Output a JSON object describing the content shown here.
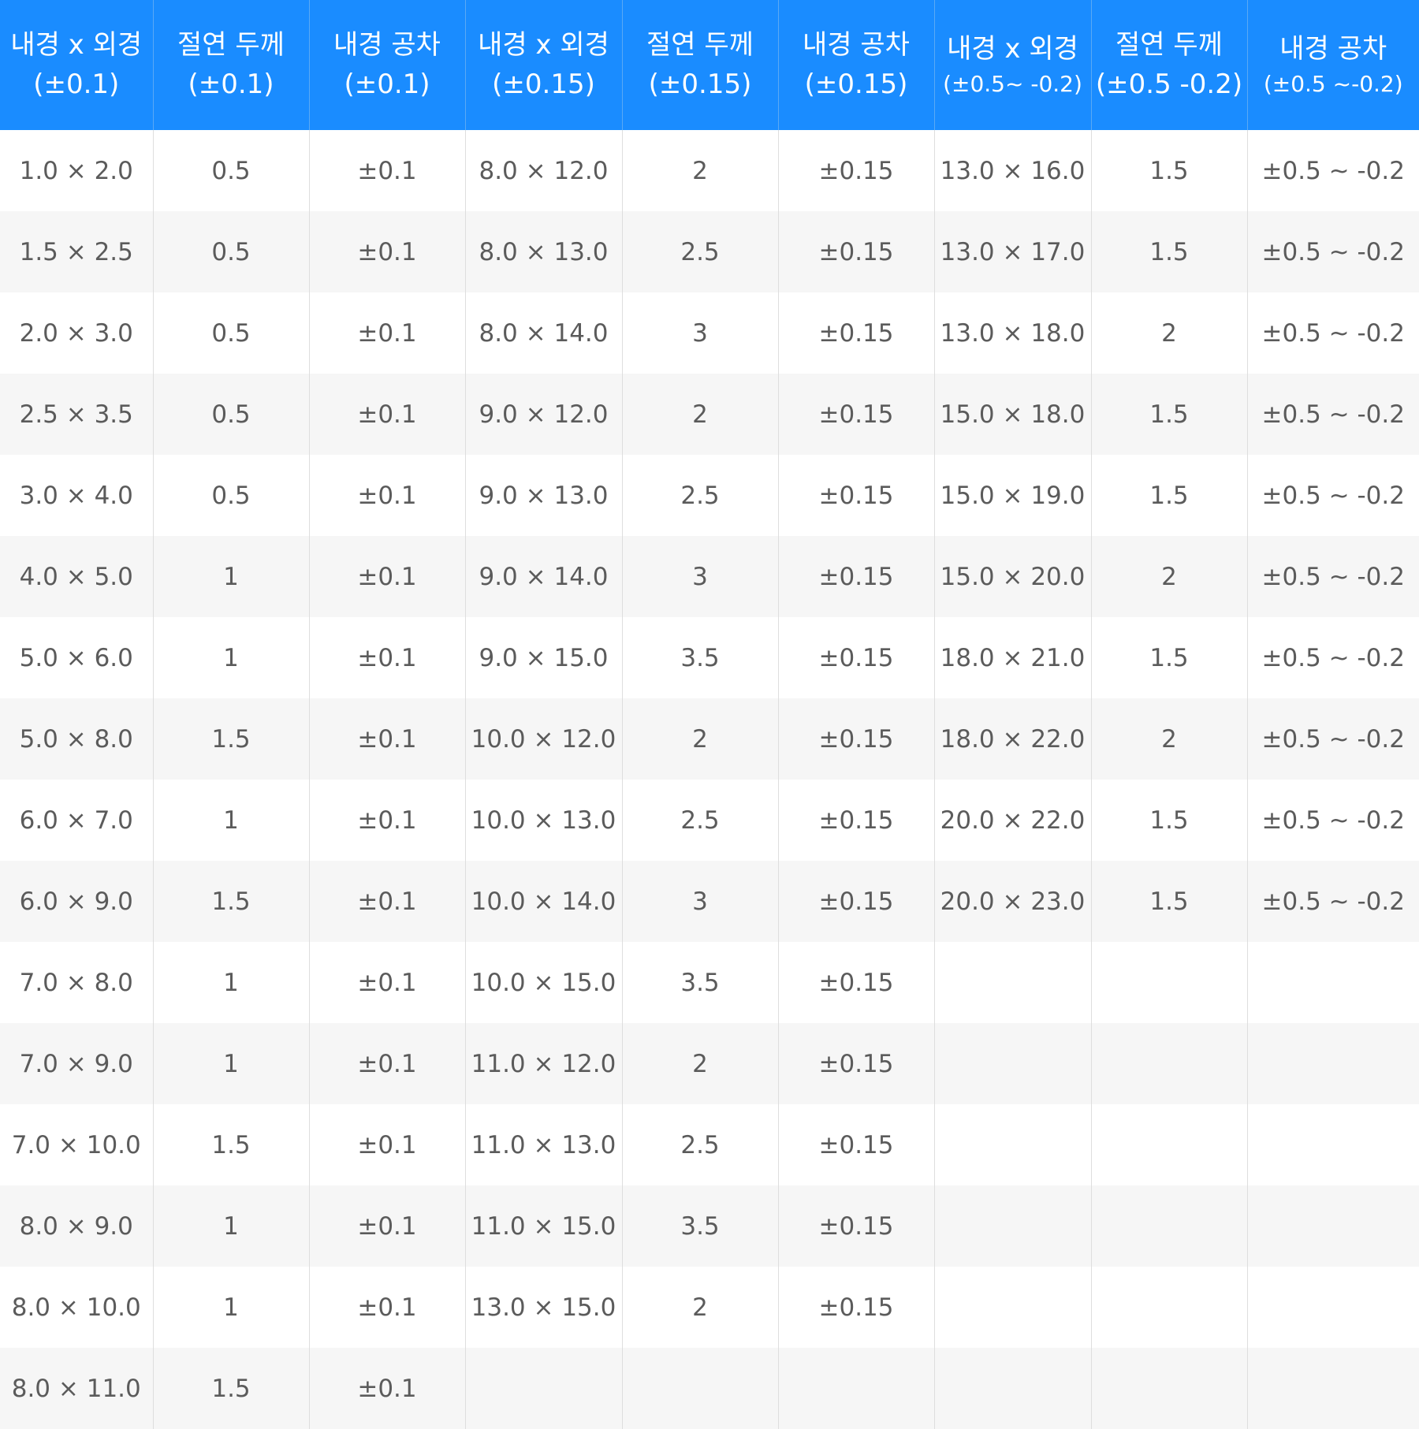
{
  "headers": [
    {
      "line1": "내경 x 외경",
      "line2": "(±0.1)"
    },
    {
      "line1": "절연 두께",
      "line2": "(±0.1)"
    },
    {
      "line1": "내경 공차",
      "line2": "(±0.1)"
    },
    {
      "line1": "내경 x 외경",
      "line2": "(±0.15)"
    },
    {
      "line1": "절연 두께",
      "line2": "(±0.15)"
    },
    {
      "line1": "내경 공차",
      "line2": "(±0.15)"
    },
    {
      "line1": "내경 x 외경",
      "line2": "(±0.5~ -0.2)"
    },
    {
      "line1": "절연 두께",
      "line2": "(±0.5 -0.2)"
    },
    {
      "line1": "내경 공차",
      "line2": "(±0.5 ~-0.2)"
    }
  ],
  "rows": [
    [
      "1.0 × 2.0",
      "0.5",
      "±0.1",
      "8.0 × 12.0",
      "2",
      "±0.15",
      "13.0 × 16.0",
      "1.5",
      "±0.5 ~ -0.2"
    ],
    [
      "1.5 × 2.5",
      "0.5",
      "±0.1",
      "8.0 × 13.0",
      "2.5",
      "±0.15",
      "13.0 × 17.0",
      "1.5",
      "±0.5 ~ -0.2"
    ],
    [
      "2.0 × 3.0",
      "0.5",
      "±0.1",
      "8.0 × 14.0",
      "3",
      "±0.15",
      "13.0 × 18.0",
      "2",
      "±0.5 ~ -0.2"
    ],
    [
      "2.5 × 3.5",
      "0.5",
      "±0.1",
      "9.0 × 12.0",
      "2",
      "±0.15",
      "15.0 × 18.0",
      "1.5",
      "±0.5 ~ -0.2"
    ],
    [
      "3.0 × 4.0",
      "0.5",
      "±0.1",
      "9.0 × 13.0",
      "2.5",
      "±0.15",
      "15.0 × 19.0",
      "1.5",
      "±0.5 ~ -0.2"
    ],
    [
      "4.0 × 5.0",
      "1",
      "±0.1",
      "9.0 × 14.0",
      "3",
      "±0.15",
      "15.0 × 20.0",
      "2",
      "±0.5 ~ -0.2"
    ],
    [
      "5.0 × 6.0",
      "1",
      "±0.1",
      "9.0 × 15.0",
      "3.5",
      "±0.15",
      "18.0 × 21.0",
      "1.5",
      "±0.5 ~ -0.2"
    ],
    [
      "5.0 × 8.0",
      "1.5",
      "±0.1",
      "10.0 × 12.0",
      "2",
      "±0.15",
      "18.0 × 22.0",
      "2",
      "±0.5 ~ -0.2"
    ],
    [
      "6.0 × 7.0",
      "1",
      "±0.1",
      "10.0 × 13.0",
      "2.5",
      "±0.15",
      "20.0 × 22.0",
      "1.5",
      "±0.5 ~ -0.2"
    ],
    [
      "6.0 × 9.0",
      "1.5",
      "±0.1",
      "10.0 × 14.0",
      "3",
      "±0.15",
      "20.0 × 23.0",
      "1.5",
      "±0.5 ~ -0.2"
    ],
    [
      "7.0 × 8.0",
      "1",
      "±0.1",
      "10.0 × 15.0",
      "3.5",
      "±0.15",
      "",
      "",
      ""
    ],
    [
      "7.0 × 9.0",
      "1",
      "±0.1",
      "11.0 × 12.0",
      "2",
      "±0.15",
      "",
      "",
      ""
    ],
    [
      "7.0 × 10.0",
      "1.5",
      "±0.1",
      "11.0 × 13.0",
      "2.5",
      "±0.15",
      "",
      "",
      ""
    ],
    [
      "8.0 × 9.0",
      "1",
      "±0.1",
      "11.0 × 15.0",
      "3.5",
      "±0.15",
      "",
      "",
      ""
    ],
    [
      "8.0 × 10.0",
      "1",
      "±0.1",
      "13.0 × 15.0",
      "2",
      "±0.15",
      "",
      "",
      ""
    ],
    [
      "8.0 × 11.0",
      "1.5",
      "±0.1",
      "",
      "",
      "",
      "",
      "",
      ""
    ]
  ]
}
